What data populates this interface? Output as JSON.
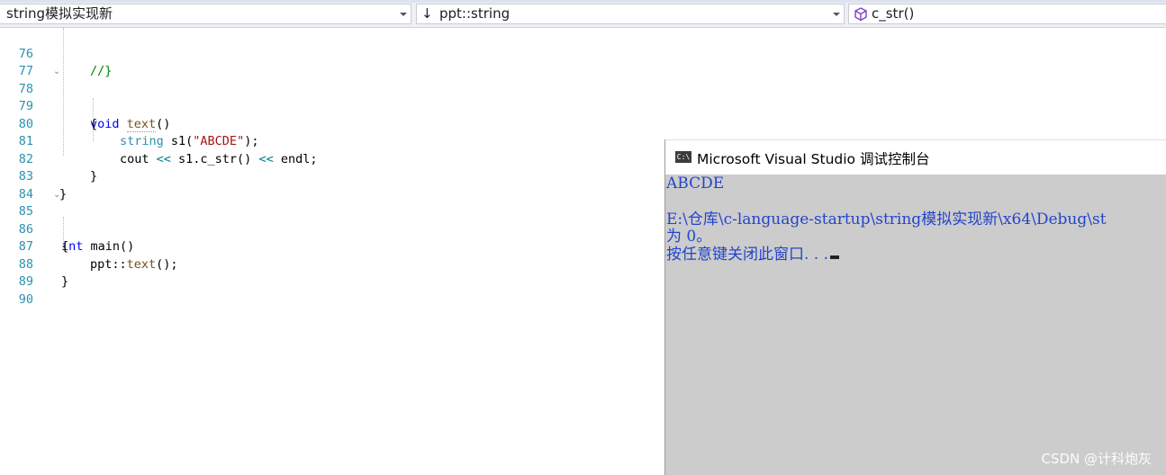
{
  "toolbar": {
    "project_dropdown": "string模拟实现新",
    "scope_dropdown": "ppt::string",
    "member_dropdown": "c_str()"
  },
  "editor": {
    "lines": [
      {
        "num": "76",
        "code": "//}"
      },
      {
        "num": "77",
        "code": ""
      },
      {
        "num": "78",
        "code": "void text()"
      },
      {
        "num": "79",
        "code": "{"
      },
      {
        "num": "80",
        "code": "string s1(\"ABCDE\");"
      },
      {
        "num": "81",
        "code": "cout << s1.c_str() << endl;"
      },
      {
        "num": "82",
        "code": "}"
      },
      {
        "num": "83",
        "code": "}"
      },
      {
        "num": "84",
        "code": ""
      },
      {
        "num": "85",
        "code": "int main()"
      },
      {
        "num": "86",
        "code": "{"
      },
      {
        "num": "87",
        "code": "ppt::text();"
      },
      {
        "num": "88",
        "code": "}"
      },
      {
        "num": "89",
        "code": ""
      },
      {
        "num": "90",
        "code": ""
      }
    ]
  },
  "console": {
    "icon_text": "C:\\",
    "title": "Microsoft Visual Studio 调试控制台",
    "output_lines": [
      "ABCDE",
      "",
      "E:\\仓库\\c-language-startup\\string模拟实现新\\x64\\Debug\\st",
      "为 0。",
      "按任意键关闭此窗口. . ."
    ]
  },
  "watermark": "CSDN @计科炮灰",
  "colors": {
    "keyword": "#0000ff",
    "type": "#2b91af",
    "string": "#a31515",
    "comment": "#008000",
    "function": "#74531f",
    "console_text": "#2244cc",
    "console_bg": "#cccccc"
  }
}
